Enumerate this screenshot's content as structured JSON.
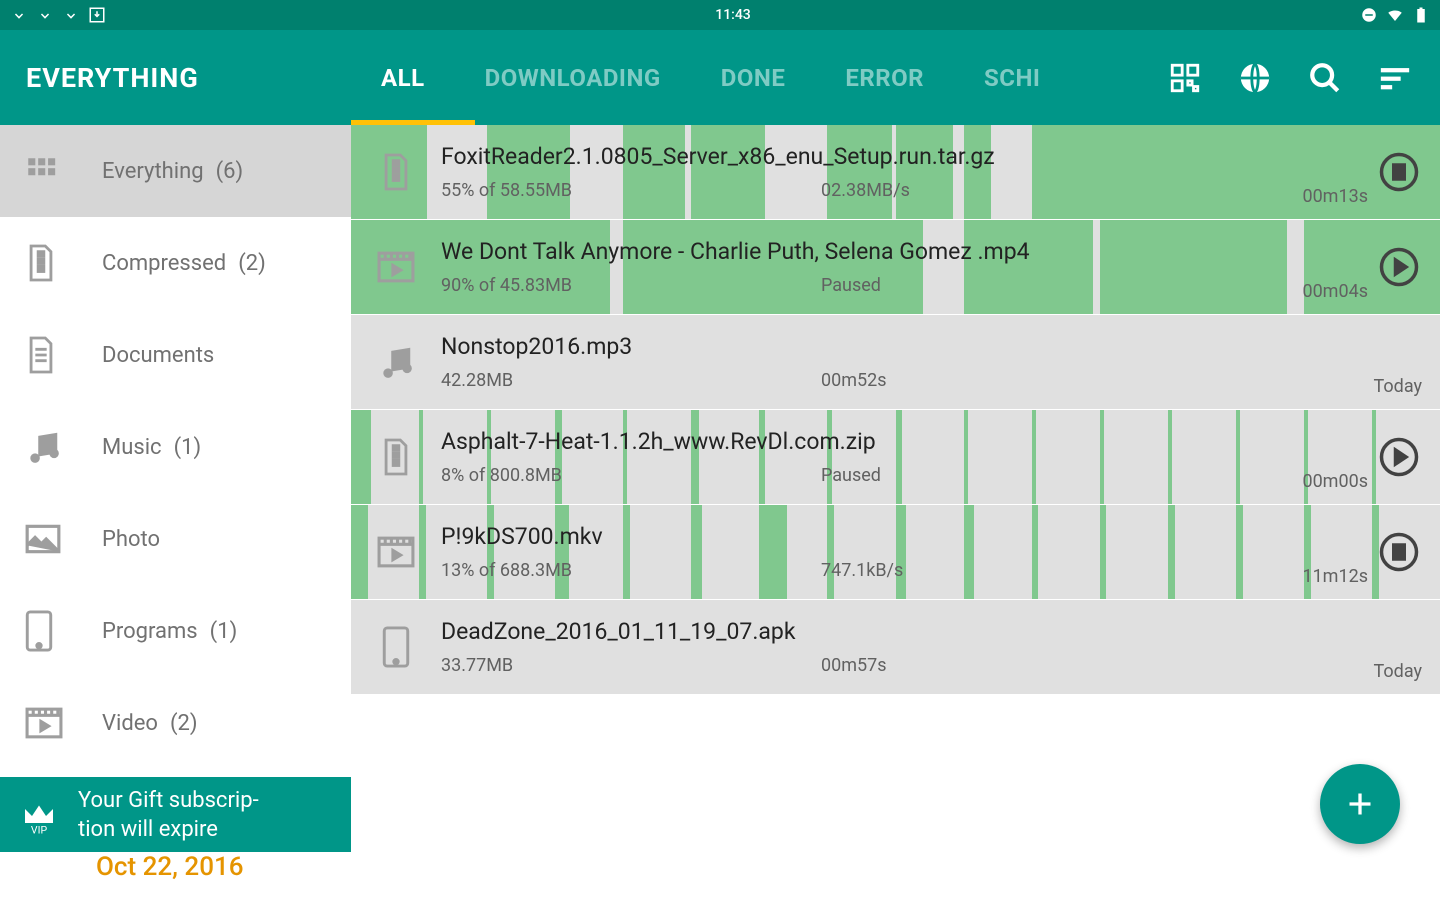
{
  "status": {
    "time": "11:43"
  },
  "sidebar": {
    "title": "EVERYTHING",
    "items": [
      {
        "label": "Everything",
        "count": "(6)",
        "icon": "grid"
      },
      {
        "label": "Compressed",
        "count": "(2)",
        "icon": "archive"
      },
      {
        "label": "Documents",
        "count": "",
        "icon": "document"
      },
      {
        "label": "Music",
        "count": "(1)",
        "icon": "music"
      },
      {
        "label": "Photo",
        "count": "",
        "icon": "photo"
      },
      {
        "label": "Programs",
        "count": "(1)",
        "icon": "phone"
      },
      {
        "label": "Video",
        "count": "(2)",
        "icon": "video"
      }
    ]
  },
  "vip": {
    "text": "Your Gift subscrip-\ntion will expire",
    "date": "Oct 22, 2016"
  },
  "tabs": [
    "ALL",
    "DOWNLOADING",
    "DONE",
    "ERROR",
    "SCHI"
  ],
  "downloads": [
    {
      "name": "FoxitReader2.1.0805_Server_x86_enu_Setup.run.tar.gz",
      "meta1": "55% of 58.55MB",
      "meta2": "02.38MB/s",
      "time": "00m13s",
      "icon": "archive",
      "action": "pause",
      "segments": [
        100,
        12,
        100,
        22,
        90,
        100,
        8,
        95,
        85,
        40,
        100,
        100,
        100,
        100,
        100,
        100
      ]
    },
    {
      "name": "We Dont Talk Anymore - Charlie Puth, Selena Gomez    .mp4",
      "meta1": "90% of 45.83MB",
      "meta2": "Paused",
      "time": "00m04s",
      "icon": "video",
      "action": "play",
      "segments": [
        100,
        100,
        100,
        80,
        100,
        100,
        100,
        100,
        40,
        100,
        90,
        100,
        100,
        75,
        100,
        100
      ]
    },
    {
      "name": "Nonstop2016.mp3",
      "meta1": "42.28MB",
      "meta2": "00m52s",
      "time": "Today",
      "icon": "music",
      "action": "none",
      "segments": []
    },
    {
      "name": "Asphalt-7-Heat-1.1.2h_www.RevDl.com.zip",
      "meta1": "8% of 800.8MB",
      "meta2": "Paused",
      "time": "00m00s",
      "icon": "archive",
      "action": "play",
      "segments": [
        30,
        6,
        6,
        10,
        6,
        12,
        8,
        6,
        10,
        6,
        6,
        6,
        6,
        6,
        6,
        6
      ]
    },
    {
      "name": "P!9kDS700.mkv",
      "meta1": "13% of 688.3MB",
      "meta2": "747.1kB/s",
      "time": "11m12s",
      "icon": "video",
      "action": "pause",
      "segments": [
        25,
        10,
        10,
        20,
        10,
        15,
        40,
        10,
        15,
        15,
        10,
        10,
        10,
        10,
        10,
        10
      ]
    },
    {
      "name": "DeadZone_2016_01_11_19_07.apk",
      "meta1": "33.77MB",
      "meta2": "00m57s",
      "time": "Today",
      "icon": "phone",
      "action": "none",
      "segments": []
    }
  ]
}
